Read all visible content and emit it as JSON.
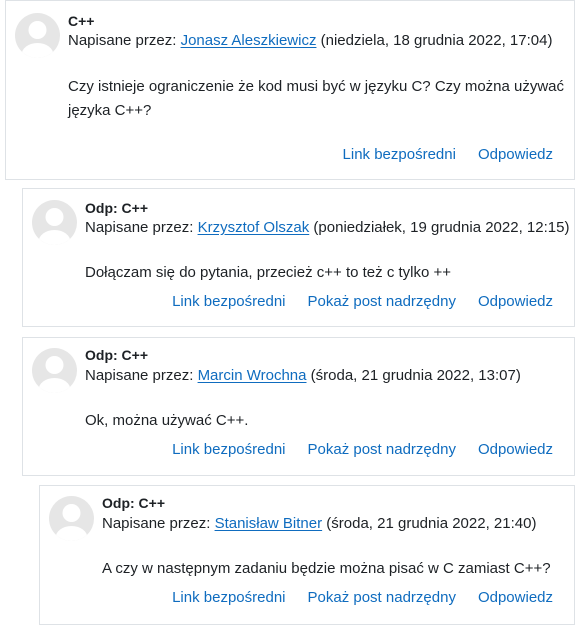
{
  "posts": [
    {
      "subject": "C++",
      "by_prefix": "Napisane przez: ",
      "author": "Jonasz Aleszkiewicz",
      "date": " (niedziela, 18 grudnia 2022, 17:04)",
      "content": "Czy istnieje ograniczenie że kod musi być w języku C? Czy można używać języka C++?",
      "link_label": "Link bezpośredni",
      "parent_label": "",
      "reply_label": "Odpowiedz"
    },
    {
      "subject": "Odp: C++",
      "by_prefix": "Napisane przez: ",
      "author": "Krzysztof Olszak",
      "date": " (poniedziałek, 19 grudnia 2022, 12:15)",
      "content": "Dołączam się do pytania, przecież c++ to też c tylko ++",
      "link_label": "Link bezpośredni",
      "parent_label": "Pokaż post nadrzędny",
      "reply_label": "Odpowiedz"
    },
    {
      "subject": "Odp: C++",
      "by_prefix": "Napisane przez: ",
      "author": "Marcin Wrochna",
      "date": " (środa, 21 grudnia 2022, 13:07)",
      "content": "Ok, można używać C++.",
      "link_label": "Link bezpośredni",
      "parent_label": "Pokaż post nadrzędny",
      "reply_label": "Odpowiedz"
    },
    {
      "subject": "Odp: C++",
      "by_prefix": "Napisane przez: ",
      "author": "Stanisław Bitner",
      "date": " (środa, 21 grudnia 2022, 21:40)",
      "content": "A czy w następnym zadaniu będzie można pisać w C zamiast C++?",
      "link_label": "Link bezpośredni",
      "parent_label": "Pokaż post nadrzędny",
      "reply_label": "Odpowiedz"
    }
  ],
  "colors": {
    "link": "#0f6cbf",
    "border": "#dee2e6",
    "avatar_bg": "#e6e6e6",
    "avatar_fg": "#ffffff"
  },
  "icons": {
    "avatar": "default-user-avatar-icon"
  }
}
